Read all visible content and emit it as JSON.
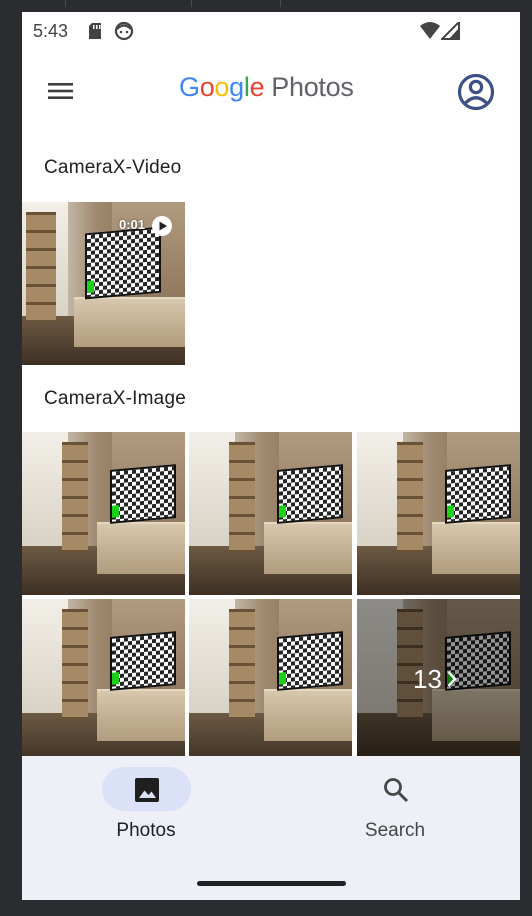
{
  "status_bar": {
    "time": "5:43",
    "icons": [
      "sd-card-icon",
      "face-icon",
      "wifi-icon",
      "signal-icon"
    ]
  },
  "app_bar": {
    "logo": {
      "google": "Google",
      "product": "Photos"
    },
    "icons": [
      "menu-icon",
      "account-circle-icon"
    ]
  },
  "sections": [
    {
      "title": "CameraX-Video",
      "items": [
        {
          "type": "video",
          "duration": "0:01"
        }
      ]
    },
    {
      "title": "CameraX-Image",
      "items": [
        {
          "type": "image"
        },
        {
          "type": "image"
        },
        {
          "type": "image"
        },
        {
          "type": "image"
        },
        {
          "type": "image"
        },
        {
          "type": "more",
          "count": "13"
        }
      ]
    }
  ],
  "bottom_nav": {
    "items": [
      {
        "label": "Photos",
        "icon": "photo-icon",
        "selected": true
      },
      {
        "label": "Search",
        "icon": "search-icon",
        "selected": false
      }
    ]
  },
  "colors": {
    "google_blue": "#4285F4",
    "google_red": "#EA4335",
    "google_yellow": "#FBBC05",
    "google_green": "#34A853",
    "nav_background": "#eff0f7",
    "nav_selected_pill": "#dbe1f6",
    "account_icon": "#3c4f86"
  }
}
